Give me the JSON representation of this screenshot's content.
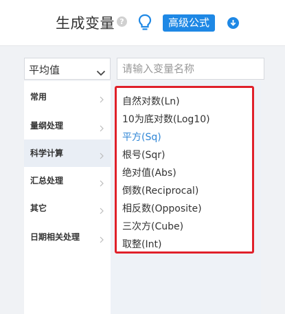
{
  "header": {
    "title": "生成变量",
    "advanced_button": "高级公式",
    "help_icon": "question-icon",
    "bulb_icon": "lightbulb-icon",
    "download_icon": "download-icon",
    "accent_color": "#1e88e5"
  },
  "filter": {
    "select_value": "平均值",
    "search_placeholder": "请输入变量名称",
    "search_value": ""
  },
  "sidebar": {
    "items": [
      {
        "label": "常用",
        "active": false
      },
      {
        "label": "量纲处理",
        "active": false
      },
      {
        "label": "科学计算",
        "active": true
      },
      {
        "label": "汇总处理",
        "active": false
      },
      {
        "label": "其它",
        "active": false
      },
      {
        "label": "日期相关处理",
        "active": false
      }
    ]
  },
  "functions": {
    "items": [
      {
        "label": "自然对数(Ln)",
        "selected": false
      },
      {
        "label": "10为底对数(Log10)",
        "selected": false
      },
      {
        "label": "平方(Sq)",
        "selected": true
      },
      {
        "label": "根号(Sqr)",
        "selected": false
      },
      {
        "label": "绝对值(Abs)",
        "selected": false
      },
      {
        "label": "倒数(Reciprocal)",
        "selected": false
      },
      {
        "label": "相反数(Opposite)",
        "selected": false
      },
      {
        "label": "三次方(Cube)",
        "selected": false
      },
      {
        "label": "取整(Int)",
        "selected": false
      }
    ],
    "highlight_color": "#e0202a"
  }
}
